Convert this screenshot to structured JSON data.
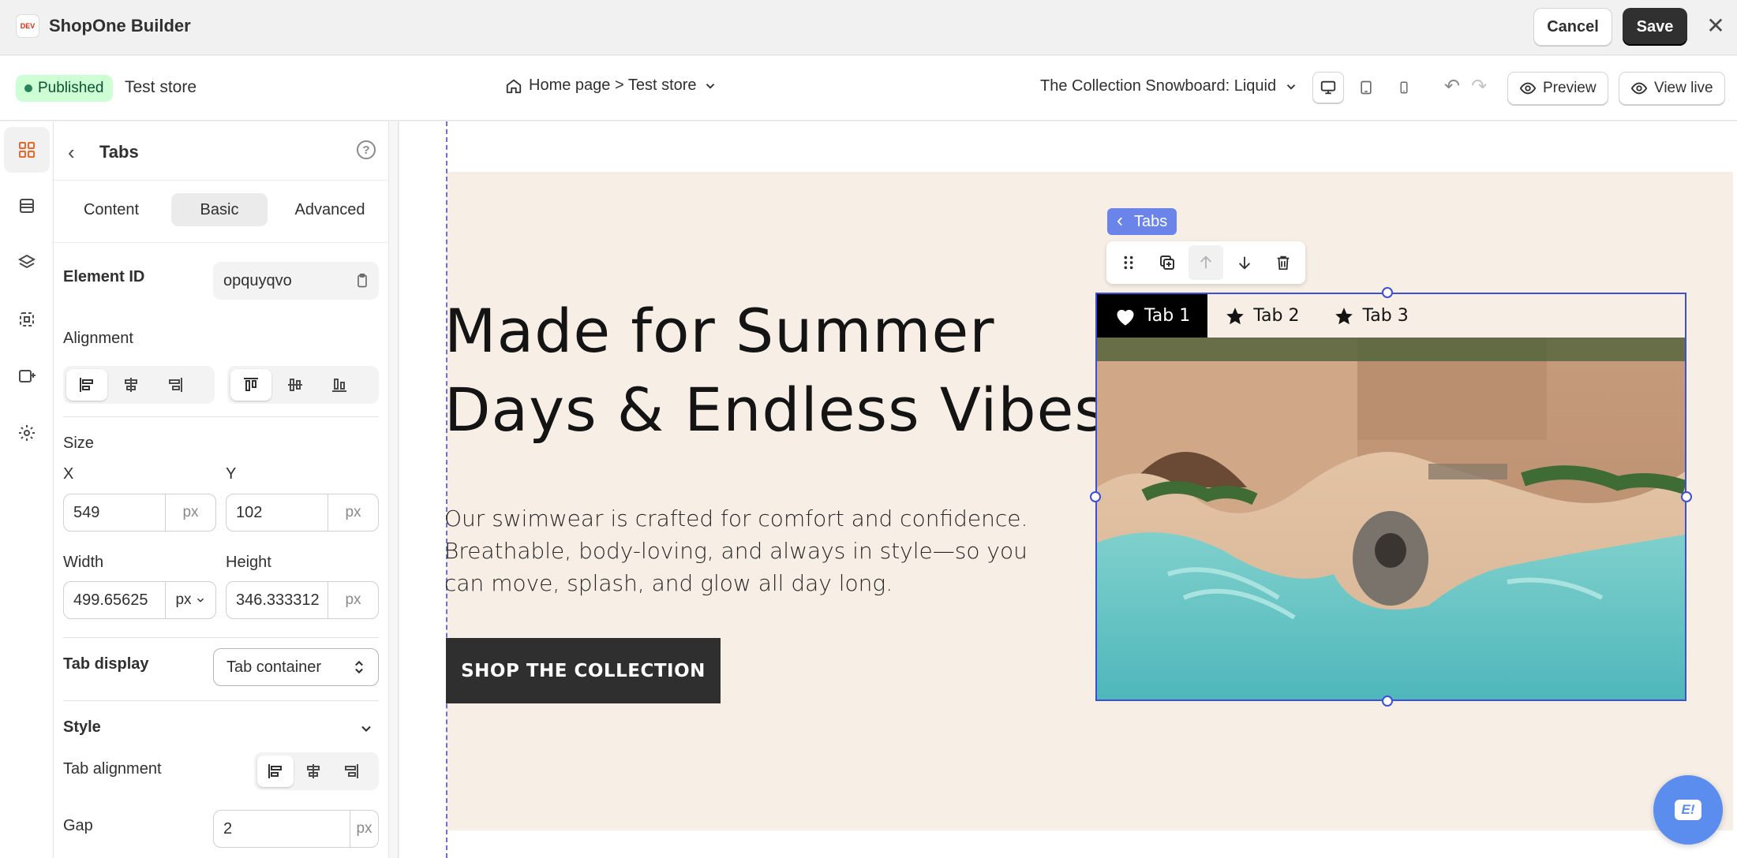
{
  "app": {
    "title": "ShopOne Builder",
    "logo_text": "DEV",
    "cancel_label": "Cancel",
    "save_label": "Save"
  },
  "subbar": {
    "status": "Published",
    "store": "Test store",
    "page": "Home page > Test store",
    "product": "The Collection Snowboard: Liquid",
    "preview_label": "Preview",
    "view_live_label": "View live"
  },
  "panel": {
    "title": "Tabs",
    "tabs": [
      "Content",
      "Basic",
      "Advanced"
    ],
    "active_tab": "Basic",
    "element_id_label": "Element ID",
    "element_id": "opquyqvo",
    "alignment_label": "Alignment",
    "size_label": "Size",
    "x_label": "X",
    "x_value": "549",
    "x_unit": "px",
    "y_label": "Y",
    "y_value": "102",
    "y_unit": "px",
    "width_label": "Width",
    "width_value": "499.65625",
    "width_unit": "px",
    "height_label": "Height",
    "height_value": "346.333312",
    "height_unit": "px",
    "tab_display_label": "Tab display",
    "tab_display_value": "Tab container",
    "style_label": "Style",
    "tab_alignment_label": "Tab alignment",
    "gap_label": "Gap",
    "gap_value": "2",
    "gap_unit": "px"
  },
  "canvas": {
    "headline_line1": "Made for Summer",
    "headline_line2": "Days & Endless Vibes",
    "body": "Our swimwear is crafted for comfort and confidence. Breathable, body-loving, and always in style—so you can move, splash, and glow all day long.",
    "cta": "SHOP THE COLLECTION",
    "element_chip": "Tabs",
    "tab_items": [
      "Tab 1",
      "Tab 2",
      "Tab 3"
    ],
    "active_tab_index": 0,
    "selection_color": "#3c4fd6",
    "hero_bg": "#f7efe6"
  },
  "colors": {
    "published_badge_bg": "#cdfed4",
    "accent_icon": "#e86a2b",
    "chat_bubble": "#5b8def"
  }
}
